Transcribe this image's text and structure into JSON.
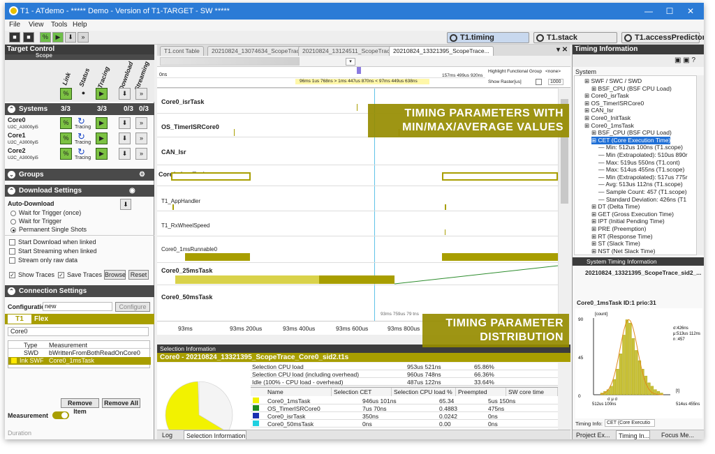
{
  "window": {
    "title": "T1 - ATdemo - ***** Demo - Version of T1-TARGET - SW *****",
    "controls": [
      "—",
      "☐",
      "✕"
    ]
  },
  "menu": [
    "File",
    "View",
    "Tools",
    "Help"
  ],
  "top_tabs": [
    "T1.timing",
    "T1.stack",
    "T1.accessPredictor"
  ],
  "target_control": {
    "title": "Target Control",
    "columns": [
      "Link",
      "Status",
      "Tracing",
      "Download",
      "Streaming"
    ],
    "scope_label": "Scope",
    "systems": {
      "label": "Systems",
      "counts": [
        "3/3",
        "3/3",
        "0/3",
        "0/3"
      ]
    },
    "cores": [
      {
        "name": "Core0",
        "sub": "U2C_A3000yi5",
        "tracing": "Tracing"
      },
      {
        "name": "Core1",
        "sub": "U2C_A3000yi5",
        "tracing": "Tracing"
      },
      {
        "name": "Core2",
        "sub": "U2C_A3000yi5",
        "tracing": "Tracing"
      }
    ],
    "groups": "Groups",
    "download_settings": "Download Settings",
    "auto_download": "Auto-Download",
    "radios": [
      "Wait for Trigger (once)",
      "Wait for Trigger",
      "Permanent Single Shots"
    ],
    "checks": [
      "Start Download when linked",
      "Start Streaming when linked",
      "Stream only raw data"
    ],
    "show_traces": "Show Traces",
    "save_traces": "Save Traces",
    "browse": "Browse",
    "reset": "Reset",
    "connection_settings": "Connection Settings",
    "configuration_label": "Configuration",
    "configuration_value": "new",
    "configure": "Configure"
  },
  "flex": {
    "title": "Flex",
    "select": "Core0",
    "headers": [
      "Type",
      "Measurement"
    ],
    "rows": [
      {
        "type": "SWD",
        "measurement": "bWrittenFromBothReadOnCore0"
      },
      {
        "type": "Ink SWF",
        "measurement": "Core0_1msTask"
      }
    ],
    "remove_item": "Remove Item",
    "remove_all": "Remove All",
    "measurement_label": "Measurement",
    "duration_label": "Duration"
  },
  "doc_tabs": [
    "T1.cont Table",
    "20210824_13074634_ScopeTrace_...",
    "20210824_13124511_ScopeTrace_...",
    "20210824_13321395_ScopeTrace..."
  ],
  "timeline": {
    "ns_label": "0ns",
    "right_time": "157ms 499us 920ns",
    "cursor_text": "96ms 1us 768ns  >  1ms 447us 870ns <  97ms 449us 638ns",
    "highlight_label": "Highlight Functional Group",
    "highlight_value": "<none>",
    "raster_label": "Show Raster[us]",
    "raster_value": "1000",
    "marker_text": "93ms 759us 79 tns",
    "rows": [
      "Core0_isrTask",
      "OS_TimerISRCore0",
      "CAN_Isr",
      "Core0_1msTask",
      "T1_AppHandler",
      "T1_RxWheelSpeed",
      "Core0_1msRunnable0",
      "Core0_25msTask",
      "Core0_50msTask"
    ],
    "xticks": [
      "93ms",
      "93ms 200us",
      "93ms 400us",
      "93ms 600us",
      "93ms 800us"
    ]
  },
  "selection": {
    "panel_title": "Selection Information",
    "title": "Core0 - 20210824_13321395_ScopeTrace_Core0_sid2.t1s",
    "summary": [
      {
        "label": "Selection CPU load",
        "value": "953us 521ns",
        "pct": "65.86%"
      },
      {
        "label": "Selection CPU load (including overhead)",
        "value": "960us 748ns",
        "pct": "66.36%"
      },
      {
        "label": "Idle (100% - CPU load - overhead)",
        "value": "487us 122ns",
        "pct": "33.64%"
      }
    ],
    "headers": [
      "Name",
      "Selection CET",
      "Selection CPU load %",
      "Preempted",
      "SW core time"
    ],
    "rows": [
      {
        "name": "Core0_1msTask",
        "cet": "946us 101ns",
        "load": "65.34",
        "pre": "5us 150ns",
        "color": "#f2f200"
      },
      {
        "name": "OS_TimerISRCore0",
        "cet": "7us 70ns",
        "load": "0.4883",
        "pre": "475ns",
        "color": "#1f8a1f"
      },
      {
        "name": "Core0_isrTask",
        "cet": "350ns",
        "load": "0.0242",
        "pre": "0ns",
        "color": "#1a2fb0"
      },
      {
        "name": "Core0_50msTask",
        "cet": "0ns",
        "load": "0.00",
        "pre": "0ns",
        "color": "#20d0e0"
      }
    ],
    "pie": {
      "busy_pct": 65.86,
      "idle_pct": 33.64
    }
  },
  "bottom_tabs": [
    "Log",
    "Selection Information"
  ],
  "timing_info": {
    "title": "Timing Information",
    "system": "System",
    "tree": [
      "SWF / SWC / SWD",
      "BSF_CPU (BSF CPU Load)",
      "Core0_isrTask",
      "OS_TimerISRCore0",
      "CAN_Isr",
      "Core0_InitTask",
      "Core0_1msTask",
      "BSF_CPU (BSF CPU Load)",
      "CET (Core Execution Time)",
      "Min: 512us 100ns (T1.scope)",
      "Min (Extrapolated): 510us 890r",
      "Max: 519us 550ns (T1.cont)",
      "Max: 514us 455ns (T1.scope)",
      "Min (Extrapolated): 517us 775r",
      "Avg: 513us 112ns (T1.scope)",
      "Sample Count: 457 (T1.scope)",
      "Standard Deviation: 426ns (T1",
      "DT (Delta Time)",
      "GET (Gross Execution Time)",
      "IPT (Initial Pending Time)",
      "PRE (Preemption)",
      "RT (Response Time)",
      "ST (Slack Time)",
      "NST (Net Slack Time)"
    ],
    "system_timing": "System Timing Information",
    "trace_file": "20210824_13321395_ScopeTrace_sid2_...",
    "hist_title": "Core0_1msTask ID:1 prio:31",
    "hist_ylabel": "[count]",
    "hist_stats": [
      "σ:426ns",
      "μ:513us 112ns",
      "n :457"
    ],
    "hist_yticks": [
      "90",
      "45",
      "0"
    ],
    "hist_xmin": "512us 100ns",
    "hist_xmax": "514us 455ns",
    "hist_xunit": "[t]",
    "hist_sym": "σ  μ  σ",
    "hist_values": [
      2,
      4,
      6,
      10,
      18,
      30,
      48,
      70,
      88,
      84,
      66,
      52,
      40,
      30,
      22,
      14,
      10,
      6,
      4,
      2
    ],
    "timing_info_label": "Timing Info:",
    "timing_info_value": "CET (Core Executio",
    "bottom_tabs": [
      "Project Ex...",
      "Timing In...",
      "Focus Me..."
    ]
  },
  "callouts": [
    "TIMING PARAMETERS WITH MIN/MAX/AVERAGE VALUES",
    "TIMING PARAMETER DISTRIBUTION"
  ]
}
